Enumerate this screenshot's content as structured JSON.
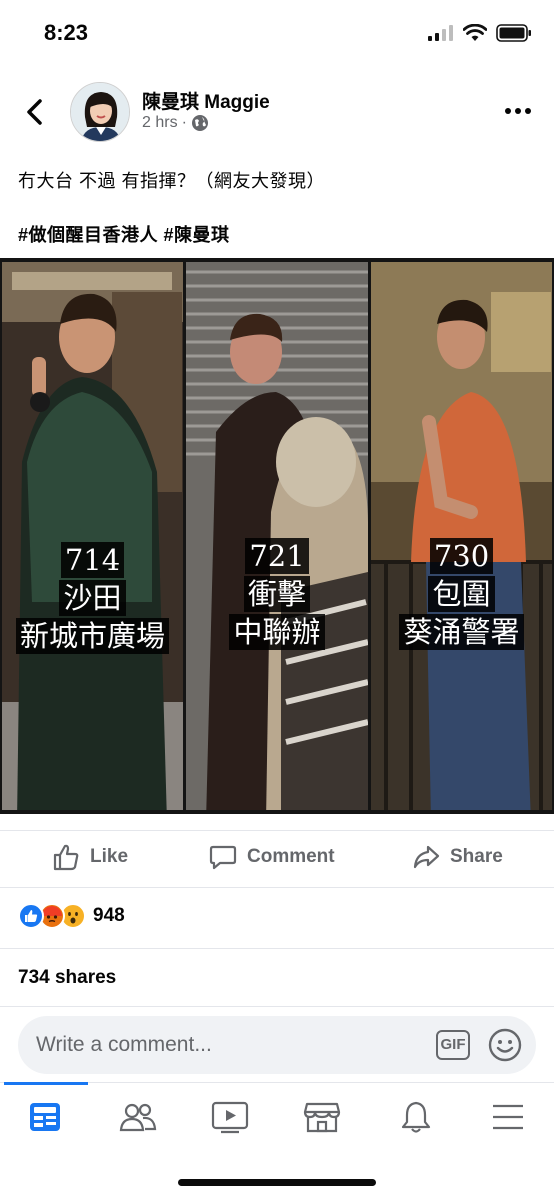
{
  "status_bar": {
    "time": "8:23"
  },
  "post": {
    "author": "陳曼琪 Maggie",
    "time_ago": "2 hrs",
    "separator": "·",
    "text": "冇大台 不過 有指揮？（網友大發現）",
    "hashtags": "#做個醒目香港人 #陳曼琪"
  },
  "photo_panels": [
    {
      "caption": [
        "714",
        "沙田",
        "新城市廣場"
      ]
    },
    {
      "caption": [
        "721",
        "衝擊",
        "中聯辦"
      ]
    },
    {
      "caption": [
        "730",
        "包圍",
        "葵涌警署"
      ]
    }
  ],
  "actions": {
    "like": "Like",
    "comment": "Comment",
    "share": "Share"
  },
  "reactions": {
    "icons": [
      "like-reaction",
      "angry-reaction",
      "wow-reaction"
    ],
    "count": "948"
  },
  "shares": "734 shares",
  "comment_input": {
    "placeholder": "Write a comment...",
    "gif_label": "GIF"
  },
  "tab_bar": {
    "tabs": [
      "news-feed",
      "groups",
      "watch",
      "marketplace",
      "notifications",
      "menu"
    ],
    "active": "news-feed"
  },
  "colors": {
    "accent": "#1877f2",
    "secondary_text": "#65676b",
    "input_bg": "#f0f2f5"
  }
}
